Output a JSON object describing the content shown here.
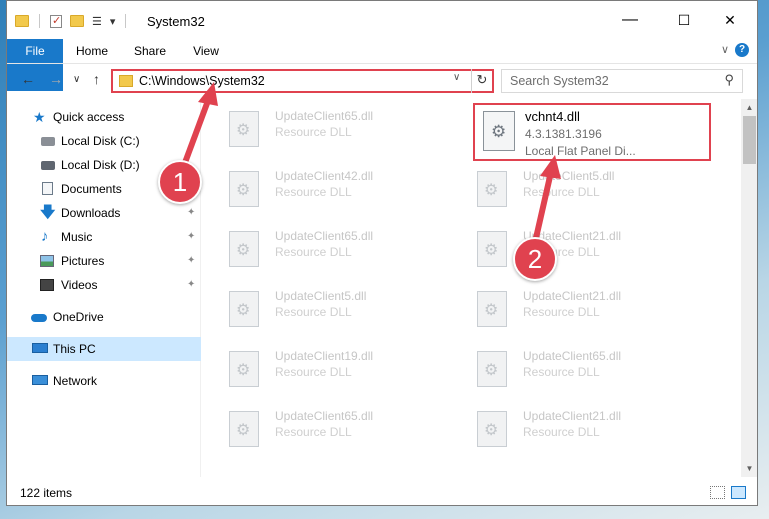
{
  "window": {
    "title": "System32",
    "controls": {
      "minimize": "—",
      "maximize": "☐",
      "close": "✕"
    }
  },
  "quick_access_toolbar": {
    "dropdown": "▾"
  },
  "ribbon": {
    "tabs": [
      "File",
      "Home",
      "Share",
      "View"
    ],
    "expand_glyph": "∨",
    "help_glyph": "?"
  },
  "nav_buttons": {
    "back": "←",
    "forward": "→",
    "recent": "∨",
    "up": "↑"
  },
  "address": {
    "path": "C:\\Windows\\System32",
    "dropdown": "∨",
    "refresh": "↻"
  },
  "search": {
    "placeholder": "Search System32",
    "icon": "search-icon"
  },
  "sidebar": {
    "items": [
      {
        "label": "Quick access",
        "icon": "star-icon",
        "pinned": false
      },
      {
        "label": "Local Disk (C:)",
        "icon": "drive-icon",
        "pinned": false
      },
      {
        "label": "Local Disk (D:)",
        "icon": "drive-icon",
        "pinned": false
      },
      {
        "label": "Documents",
        "icon": "document-icon",
        "pinned": false
      },
      {
        "label": "Downloads",
        "icon": "download-icon",
        "pinned": true
      },
      {
        "label": "Music",
        "icon": "music-icon",
        "pinned": true
      },
      {
        "label": "Pictures",
        "icon": "picture-icon",
        "pinned": true
      },
      {
        "label": "Videos",
        "icon": "video-icon",
        "pinned": true
      },
      {
        "label": "OneDrive",
        "icon": "cloud-icon",
        "pinned": false
      },
      {
        "label": "This PC",
        "icon": "computer-icon",
        "pinned": false
      },
      {
        "label": "Network",
        "icon": "network-icon",
        "pinned": false
      }
    ],
    "pin_glyph": "📌"
  },
  "files": {
    "left_column": [
      {
        "name": "UpdateClient65.dll",
        "type": "Resource DLL"
      },
      {
        "name": "UpdateClient42.dll",
        "type": "Resource DLL"
      },
      {
        "name": "UpdateClient65.dll",
        "type": "Resource DLL"
      },
      {
        "name": "UpdateClient5.dll",
        "type": "Resource DLL"
      },
      {
        "name": "UpdateClient19.dll",
        "type": "Resource DLL"
      },
      {
        "name": "UpdateClient65.dll",
        "type": "Resource DLL"
      }
    ],
    "right_column": [
      {
        "name": "UpdateClient5.dll",
        "type": "Resource DLL"
      },
      {
        "name": "UpdateClient21.dll",
        "type": "Resource DLL"
      },
      {
        "name": "UpdateClient21.dll",
        "type": "Resource DLL"
      },
      {
        "name": "UpdateClient65.dll",
        "type": "Resource DLL"
      },
      {
        "name": "UpdateClient21.dll",
        "type": "Resource DLL"
      }
    ],
    "highlighted": {
      "name": "vchnt4.dll",
      "version": "4.3.1381.3196",
      "description": "Local Flat Panel Di..."
    }
  },
  "status": {
    "item_count": "122 items"
  },
  "callouts": [
    "1",
    "2"
  ],
  "colors": {
    "accent": "#1979ca",
    "highlight": "#e0424f",
    "selected": "#cce8ff"
  }
}
